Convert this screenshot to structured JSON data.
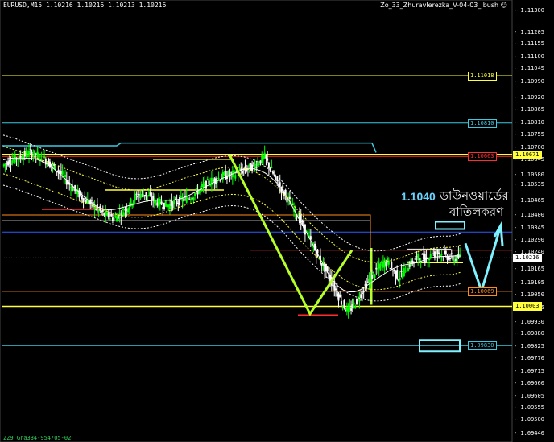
{
  "header": {
    "symbol_info": "EURUSD,M15  1.10216 1.10216 1.10213 1.10216",
    "indicator_name": "Zo_33_ZhuravIerezka_V-04-03_Ibush ☺"
  },
  "footer": {
    "text": "ZZ9 Gra334-954/05-02"
  },
  "annotation": {
    "price_text": "1.1040",
    "line1": "ডাউনওয়ার্ডের",
    "line2": "বাতিলকরণ"
  },
  "colors": {
    "background": "#000000",
    "bull": "#00ff00",
    "wave": "#b5ff2a",
    "cyan": "#3ec8e0",
    "box": "#7ff2ff",
    "yellow": "#ffff3a",
    "red": "#ff2d2d",
    "orange": "#ff8c1a",
    "blue": "#2b5cff",
    "axis": "#ffffff"
  },
  "chart_data": {
    "type": "candlestick",
    "symbol": "EURUSD",
    "timeframe": "M15",
    "ylim": [
      1.0942,
      1.1133
    ],
    "y_ticks": [
      "1.11300",
      "1.11205",
      "1.11155",
      "1.11100",
      "1.11045",
      "1.10990",
      "1.10920",
      "1.10865",
      "1.10810",
      "1.10755",
      "1.10700",
      "1.10645",
      "1.10580",
      "1.10535",
      "1.10465",
      "1.10400",
      "1.10345",
      "1.10290",
      "1.10240",
      "1.10165",
      "1.10105",
      "1.10050",
      "1.09995",
      "1.09930",
      "1.09880",
      "1.09825",
      "1.09770",
      "1.09715",
      "1.09660",
      "1.09605",
      "1.09555",
      "1.09500",
      "1.09440"
    ],
    "price_labels": [
      {
        "value": "1.11018",
        "price": 1.11018,
        "color": "#ffff3a",
        "bg": "#000000",
        "fg": "#ffff3a"
      },
      {
        "value": "1.10810",
        "price": 1.1081,
        "color": "#3ec8e0",
        "bg": "#000000",
        "fg": "#3ec8e0"
      },
      {
        "value": "1.10671",
        "price": 1.10671,
        "color": "#ffff3a",
        "bg": "#ffff3a",
        "fg": "#000000"
      },
      {
        "value": "1.10663",
        "price": 1.10663,
        "color": "#ff2d2d",
        "bg": "#000000",
        "fg": "#ff2d2d"
      },
      {
        "value": "1.10216",
        "price": 1.10216,
        "color": "#ffffff",
        "bg": "#ffffff",
        "fg": "#000000"
      },
      {
        "value": "1.10069",
        "price": 1.10069,
        "color": "#ff8c1a",
        "bg": "#000000",
        "fg": "#ff8c1a"
      },
      {
        "value": "1.10003",
        "price": 1.10003,
        "color": "#ffff3a",
        "bg": "#ffff3a",
        "fg": "#000000"
      },
      {
        "value": "1.09830",
        "price": 1.0983,
        "color": "#3ec8e0",
        "bg": "#000000",
        "fg": "#3ec8e0"
      }
    ],
    "hidden_labels": [
      {
        "value": "1.10330",
        "price": 1.1033,
        "color": "#2b5cff"
      },
      {
        "value": "1.10250",
        "price": 1.1025,
        "color": "#ff2d2d"
      }
    ],
    "close_path": [
      1.1062,
      1.1064,
      1.1065,
      1.1066,
      1.1067,
      1.1068,
      1.1067,
      1.1066,
      1.1064,
      1.1062,
      1.106,
      1.1057,
      1.1054,
      1.1051,
      1.1049,
      1.1047,
      1.1045,
      1.1043,
      1.1041,
      1.104,
      1.1039,
      1.1041,
      1.1043,
      1.1046,
      1.1049,
      1.105,
      1.1049,
      1.1047,
      1.1046,
      1.1045,
      1.1045,
      1.1046,
      1.1047,
      1.1048,
      1.1049,
      1.1051,
      1.1053,
      1.1055,
      1.1056,
      1.1057,
      1.1058,
      1.1058,
      1.1059,
      1.106,
      1.1061,
      1.1062,
      1.1064,
      1.1066,
      1.1061,
      1.1056,
      1.1052,
      1.1048,
      1.1044,
      1.104,
      1.1035,
      1.103,
      1.1025,
      1.102,
      1.1016,
      1.1011,
      1.1006,
      1.1001,
      1.0998,
      1.1001,
      1.1005,
      1.1009,
      1.1013,
      1.1016,
      1.1019,
      1.102,
      1.1016,
      1.1013,
      1.1016,
      1.1019,
      1.1021,
      1.1022,
      1.1021,
      1.1023,
      1.1024,
      1.1023,
      1.1022,
      1.1021,
      1.1022
    ],
    "wave_points": [
      [
        1.1067,
        0
      ],
      [
        1.0997,
        0.42
      ],
      [
        1.1025,
        0.52
      ],
      [
        1.1003,
        0.53
      ]
    ]
  }
}
